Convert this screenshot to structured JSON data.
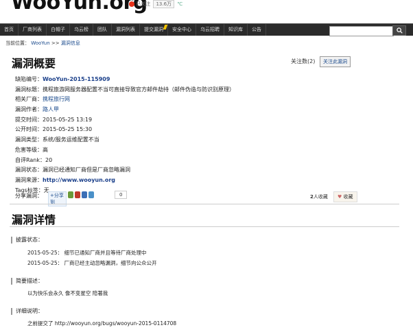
{
  "header": {
    "logo_text": "WooYun.org",
    "weibo_followed": "已关注",
    "weibo_count": "13.6万",
    "weibo_extra": "℃"
  },
  "nav": {
    "items": [
      "首页",
      "厂商列表",
      "白帽子",
      "乌云榜",
      "团队",
      "漏洞列表",
      "提交漏洞",
      "安全中心",
      "乌云招聘",
      "知识库",
      "公告"
    ],
    "search_placeholder": ""
  },
  "breadcrumb": {
    "prefix": "当前位置：",
    "root": "WooYun",
    "sep": ">>",
    "current": "漏洞信息"
  },
  "overview": {
    "title": "漏洞概要",
    "follow_text": "关注数(2)",
    "follow_button": "关注此漏洞"
  },
  "fields": [
    {
      "label": "缺陷编号：",
      "value": "WooYun-2015-115909"
    },
    {
      "label": "漏洞标题：",
      "value": "携程旅游网服务器配置不当可直接导致官方邮件劫持（邮件伪造与防识别原理）"
    },
    {
      "label": "相关厂商：",
      "value": "携程旅行网"
    },
    {
      "label": "漏洞作者：",
      "value": "路人甲"
    },
    {
      "label": "提交时间：",
      "value": "2015-05-25 13:19"
    },
    {
      "label": "公开时间：",
      "value": "2015-05-25 15:30"
    },
    {
      "label": "漏洞类型：",
      "value": "系统/服务运维配置不当"
    },
    {
      "label": "危害等级：",
      "value": "高"
    },
    {
      "label": "自评Rank：",
      "value": "20"
    },
    {
      "label": "漏洞状态：",
      "value": "漏洞已经通知厂商但是厂商忽略漏洞"
    },
    {
      "label": "漏洞来源：",
      "value": "http://www.wooyun.org"
    },
    {
      "label": "Tags标签：",
      "value": "无"
    }
  ],
  "share": {
    "label": "分享漏洞：",
    "share_to": "分享到",
    "count": "0"
  },
  "favorites": {
    "count": "2",
    "count_suffix": "人收藏",
    "button": "收藏"
  },
  "details": {
    "title": "漏洞详情",
    "disclosure_label": "披露状态：",
    "disclosure_items": [
      {
        "date": "2015-05-25：",
        "text": "细节已通知厂商并且等待厂商处理中"
      },
      {
        "date": "2015-05-25：",
        "text": "厂商已经主动忽略漏洞，细节向公众公开"
      }
    ],
    "summary_label": "简要描述：",
    "summary_text": "以为快乐会永久 像不变星空 陪著我",
    "detail_label": "详细说明：",
    "detail_text": "之前提交了 http://wooyun.org/bugs/wooyun-2015-0114708"
  }
}
